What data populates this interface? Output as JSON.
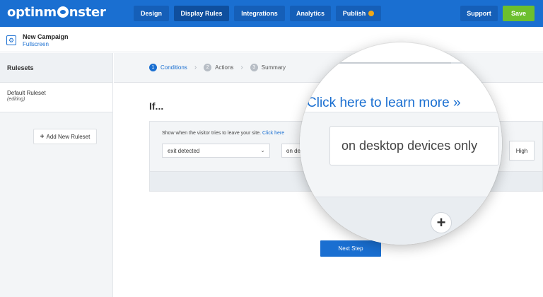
{
  "app": {
    "logo_pre": "optinm",
    "logo_post": "nster"
  },
  "topnav": {
    "items": [
      {
        "label": "Design"
      },
      {
        "label": "Display Rules"
      },
      {
        "label": "Integrations"
      },
      {
        "label": "Analytics"
      },
      {
        "label": "Publish"
      }
    ],
    "support_label": "Support",
    "save_label": "Save"
  },
  "campaign": {
    "title": "New Campaign",
    "type": "Fullscreen"
  },
  "sidebar": {
    "header": "Rulesets",
    "items": [
      {
        "name": "Default Ruleset",
        "status": "(editing)"
      }
    ],
    "add_label": "Add New Ruleset"
  },
  "steps": [
    {
      "num": "1",
      "label": "Conditions"
    },
    {
      "num": "2",
      "label": "Actions"
    },
    {
      "num": "3",
      "label": "Summary"
    }
  ],
  "main": {
    "if_title": "If...",
    "rule_text": "Show when the visitor tries to leave your site.",
    "rule_link": "Click here",
    "select_trigger": "exit detected",
    "select_device_partial": "on de",
    "high_label": "High",
    "next_step_label": "Next Step"
  },
  "magnifier": {
    "link_text": "Click here to learn more »",
    "device_value": "on desktop devices only",
    "low_partial": "n",
    "high_label": "High",
    "add_icon": "plus-icon"
  }
}
